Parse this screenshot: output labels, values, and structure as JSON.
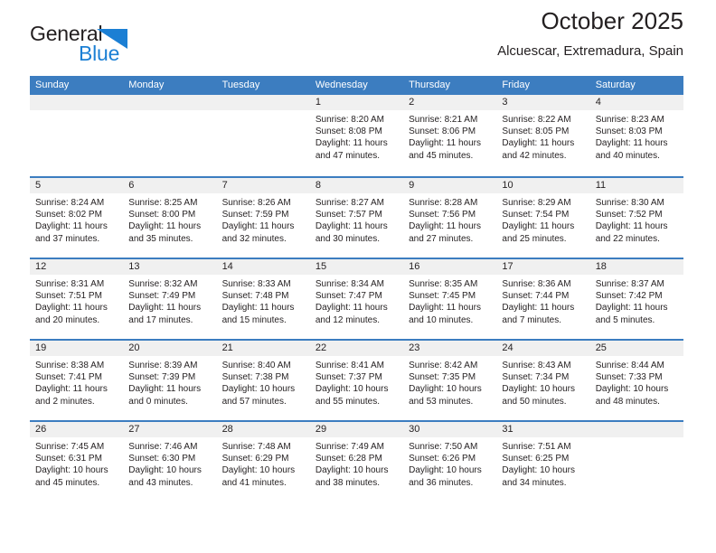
{
  "brand": {
    "name_line1": "General",
    "name_line2": "Blue",
    "triangle_icon": "triangle-icon",
    "accent_color": "#1b7fd4"
  },
  "header": {
    "title": "October 2025",
    "subtitle": "Alcuescar, Extremadura, Spain"
  },
  "theme": {
    "header_blue": "#3c7dc0",
    "day_band_gray": "#f0f0f0",
    "text_color": "#231f20"
  },
  "weekdays": [
    "Sunday",
    "Monday",
    "Tuesday",
    "Wednesday",
    "Thursday",
    "Friday",
    "Saturday"
  ],
  "labels": {
    "sunrise_prefix": "Sunrise:",
    "sunset_prefix": "Sunset:",
    "daylight_prefix": "Daylight:"
  },
  "weeks": [
    [
      {
        "day": "",
        "empty": true
      },
      {
        "day": "",
        "empty": true
      },
      {
        "day": "",
        "empty": true
      },
      {
        "day": "1",
        "sunrise": "Sunrise: 8:20 AM",
        "sunset": "Sunset: 8:08 PM",
        "daylight": "Daylight: 11 hours and 47 minutes."
      },
      {
        "day": "2",
        "sunrise": "Sunrise: 8:21 AM",
        "sunset": "Sunset: 8:06 PM",
        "daylight": "Daylight: 11 hours and 45 minutes."
      },
      {
        "day": "3",
        "sunrise": "Sunrise: 8:22 AM",
        "sunset": "Sunset: 8:05 PM",
        "daylight": "Daylight: 11 hours and 42 minutes."
      },
      {
        "day": "4",
        "sunrise": "Sunrise: 8:23 AM",
        "sunset": "Sunset: 8:03 PM",
        "daylight": "Daylight: 11 hours and 40 minutes."
      }
    ],
    [
      {
        "day": "5",
        "sunrise": "Sunrise: 8:24 AM",
        "sunset": "Sunset: 8:02 PM",
        "daylight": "Daylight: 11 hours and 37 minutes."
      },
      {
        "day": "6",
        "sunrise": "Sunrise: 8:25 AM",
        "sunset": "Sunset: 8:00 PM",
        "daylight": "Daylight: 11 hours and 35 minutes."
      },
      {
        "day": "7",
        "sunrise": "Sunrise: 8:26 AM",
        "sunset": "Sunset: 7:59 PM",
        "daylight": "Daylight: 11 hours and 32 minutes."
      },
      {
        "day": "8",
        "sunrise": "Sunrise: 8:27 AM",
        "sunset": "Sunset: 7:57 PM",
        "daylight": "Daylight: 11 hours and 30 minutes."
      },
      {
        "day": "9",
        "sunrise": "Sunrise: 8:28 AM",
        "sunset": "Sunset: 7:56 PM",
        "daylight": "Daylight: 11 hours and 27 minutes."
      },
      {
        "day": "10",
        "sunrise": "Sunrise: 8:29 AM",
        "sunset": "Sunset: 7:54 PM",
        "daylight": "Daylight: 11 hours and 25 minutes."
      },
      {
        "day": "11",
        "sunrise": "Sunrise: 8:30 AM",
        "sunset": "Sunset: 7:52 PM",
        "daylight": "Daylight: 11 hours and 22 minutes."
      }
    ],
    [
      {
        "day": "12",
        "sunrise": "Sunrise: 8:31 AM",
        "sunset": "Sunset: 7:51 PM",
        "daylight": "Daylight: 11 hours and 20 minutes."
      },
      {
        "day": "13",
        "sunrise": "Sunrise: 8:32 AM",
        "sunset": "Sunset: 7:49 PM",
        "daylight": "Daylight: 11 hours and 17 minutes."
      },
      {
        "day": "14",
        "sunrise": "Sunrise: 8:33 AM",
        "sunset": "Sunset: 7:48 PM",
        "daylight": "Daylight: 11 hours and 15 minutes."
      },
      {
        "day": "15",
        "sunrise": "Sunrise: 8:34 AM",
        "sunset": "Sunset: 7:47 PM",
        "daylight": "Daylight: 11 hours and 12 minutes."
      },
      {
        "day": "16",
        "sunrise": "Sunrise: 8:35 AM",
        "sunset": "Sunset: 7:45 PM",
        "daylight": "Daylight: 11 hours and 10 minutes."
      },
      {
        "day": "17",
        "sunrise": "Sunrise: 8:36 AM",
        "sunset": "Sunset: 7:44 PM",
        "daylight": "Daylight: 11 hours and 7 minutes."
      },
      {
        "day": "18",
        "sunrise": "Sunrise: 8:37 AM",
        "sunset": "Sunset: 7:42 PM",
        "daylight": "Daylight: 11 hours and 5 minutes."
      }
    ],
    [
      {
        "day": "19",
        "sunrise": "Sunrise: 8:38 AM",
        "sunset": "Sunset: 7:41 PM",
        "daylight": "Daylight: 11 hours and 2 minutes."
      },
      {
        "day": "20",
        "sunrise": "Sunrise: 8:39 AM",
        "sunset": "Sunset: 7:39 PM",
        "daylight": "Daylight: 11 hours and 0 minutes."
      },
      {
        "day": "21",
        "sunrise": "Sunrise: 8:40 AM",
        "sunset": "Sunset: 7:38 PM",
        "daylight": "Daylight: 10 hours and 57 minutes."
      },
      {
        "day": "22",
        "sunrise": "Sunrise: 8:41 AM",
        "sunset": "Sunset: 7:37 PM",
        "daylight": "Daylight: 10 hours and 55 minutes."
      },
      {
        "day": "23",
        "sunrise": "Sunrise: 8:42 AM",
        "sunset": "Sunset: 7:35 PM",
        "daylight": "Daylight: 10 hours and 53 minutes."
      },
      {
        "day": "24",
        "sunrise": "Sunrise: 8:43 AM",
        "sunset": "Sunset: 7:34 PM",
        "daylight": "Daylight: 10 hours and 50 minutes."
      },
      {
        "day": "25",
        "sunrise": "Sunrise: 8:44 AM",
        "sunset": "Sunset: 7:33 PM",
        "daylight": "Daylight: 10 hours and 48 minutes."
      }
    ],
    [
      {
        "day": "26",
        "sunrise": "Sunrise: 7:45 AM",
        "sunset": "Sunset: 6:31 PM",
        "daylight": "Daylight: 10 hours and 45 minutes."
      },
      {
        "day": "27",
        "sunrise": "Sunrise: 7:46 AM",
        "sunset": "Sunset: 6:30 PM",
        "daylight": "Daylight: 10 hours and 43 minutes."
      },
      {
        "day": "28",
        "sunrise": "Sunrise: 7:48 AM",
        "sunset": "Sunset: 6:29 PM",
        "daylight": "Daylight: 10 hours and 41 minutes."
      },
      {
        "day": "29",
        "sunrise": "Sunrise: 7:49 AM",
        "sunset": "Sunset: 6:28 PM",
        "daylight": "Daylight: 10 hours and 38 minutes."
      },
      {
        "day": "30",
        "sunrise": "Sunrise: 7:50 AM",
        "sunset": "Sunset: 6:26 PM",
        "daylight": "Daylight: 10 hours and 36 minutes."
      },
      {
        "day": "31",
        "sunrise": "Sunrise: 7:51 AM",
        "sunset": "Sunset: 6:25 PM",
        "daylight": "Daylight: 10 hours and 34 minutes."
      },
      {
        "day": "",
        "empty": true
      }
    ]
  ]
}
